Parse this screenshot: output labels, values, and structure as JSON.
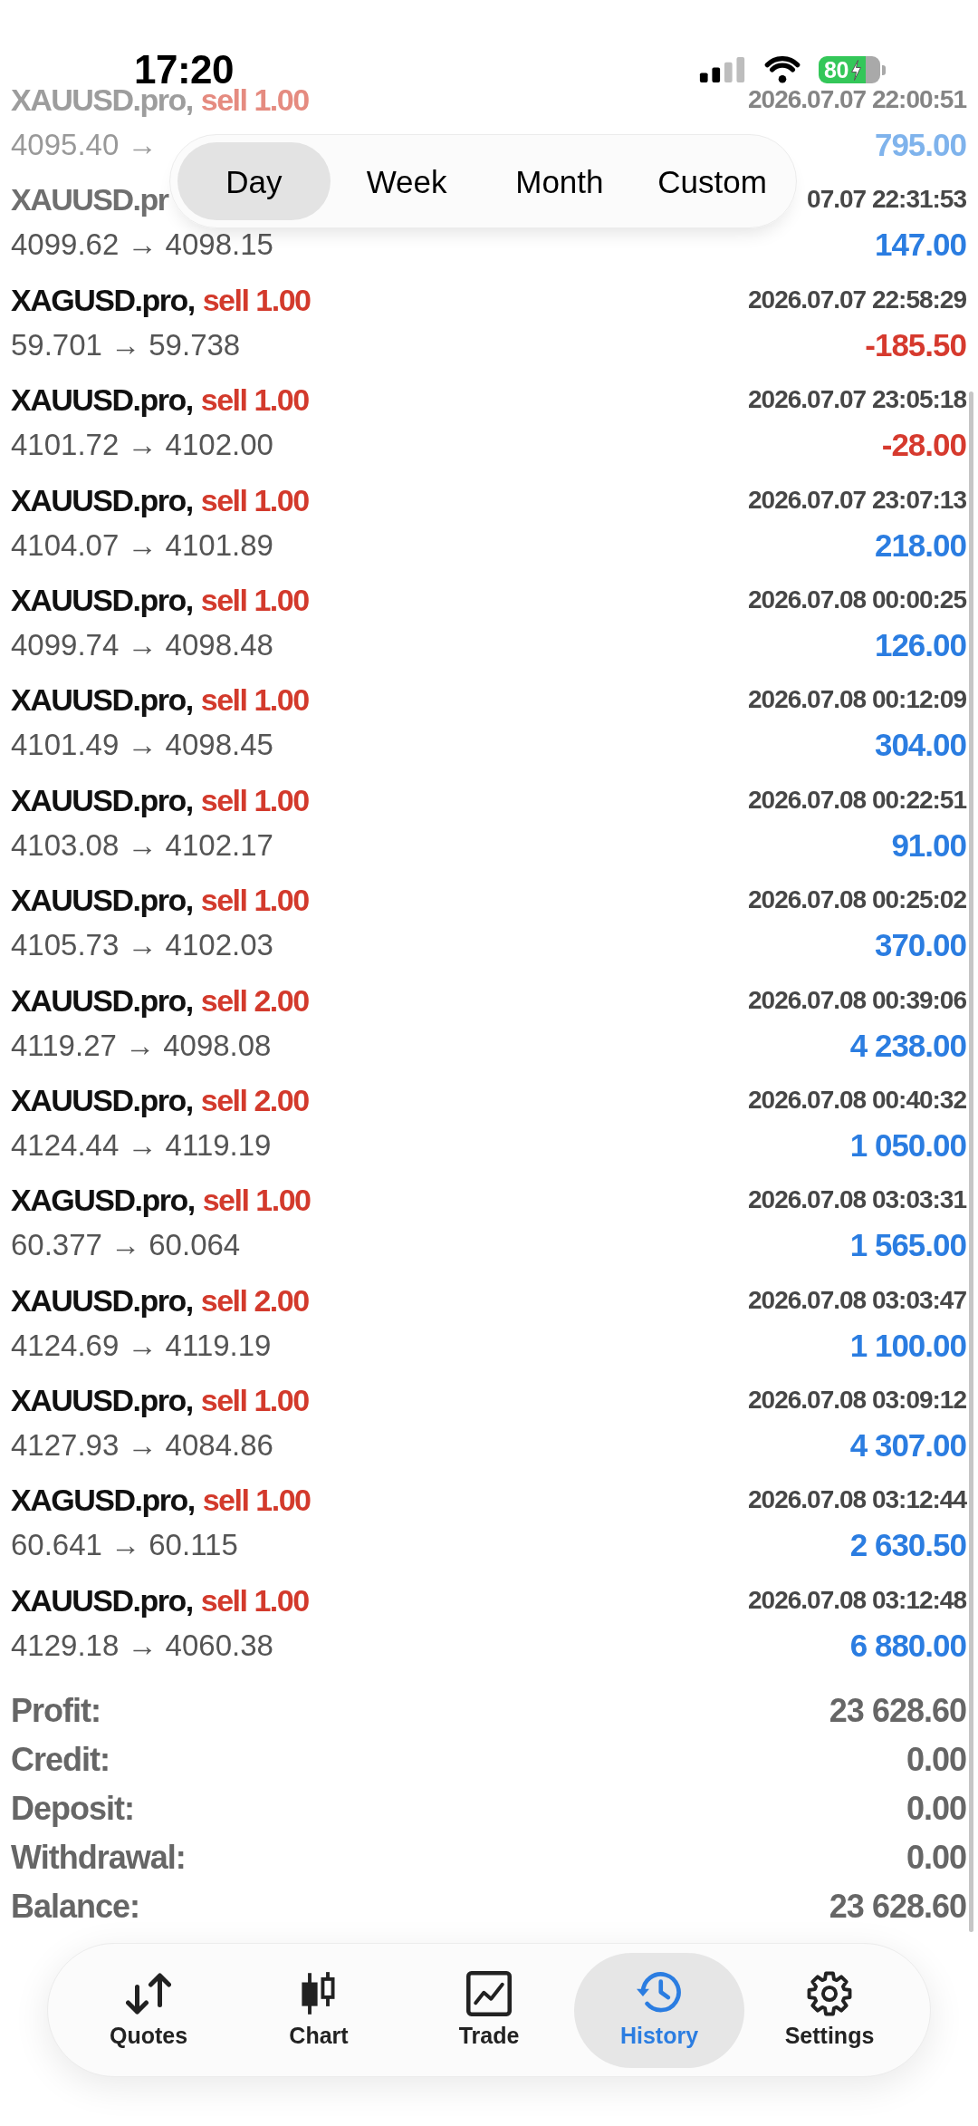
{
  "status_bar": {
    "time": "17:20",
    "battery": "80"
  },
  "period_tabs": [
    {
      "label": "Day",
      "selected": true
    },
    {
      "label": "Week",
      "selected": false
    },
    {
      "label": "Month",
      "selected": false
    },
    {
      "label": "Custom",
      "selected": false
    }
  ],
  "trades": [
    {
      "symbol": "XAUUSD.pro,",
      "side": "sell 1.00",
      "time": "2026.07.07 22:00:51",
      "prices": "4095.40 →",
      "profit": "795.00",
      "color": "#7fb3ec"
    },
    {
      "symbol": "XAUUSD.pr",
      "time": "07.07 22:31:53",
      "prices": "4099.62 → 4098.15",
      "profit": "147.00",
      "color": "#2b7de1"
    },
    {
      "symbol": "XAGUSD.pro,",
      "side": "sell 1.00",
      "time": "2026.07.07 22:58:29",
      "prices": "59.701 → 59.738",
      "profit": "-185.50",
      "color": "#d63a2e"
    },
    {
      "symbol": "XAUUSD.pro,",
      "side": "sell 1.00",
      "time": "2026.07.07 23:05:18",
      "prices": "4101.72 → 4102.00",
      "profit": "-28.00",
      "color": "#d63a2e"
    },
    {
      "symbol": "XAUUSD.pro,",
      "side": "sell 1.00",
      "time": "2026.07.07 23:07:13",
      "prices": "4104.07 → 4101.89",
      "profit": "218.00",
      "color": "#2b7de1"
    },
    {
      "symbol": "XAUUSD.pro,",
      "side": "sell 1.00",
      "time": "2026.07.08 00:00:25",
      "prices": "4099.74 → 4098.48",
      "profit": "126.00",
      "color": "#2b7de1"
    },
    {
      "symbol": "XAUUSD.pro,",
      "side": "sell 1.00",
      "time": "2026.07.08 00:12:09",
      "prices": "4101.49 → 4098.45",
      "profit": "304.00",
      "color": "#2b7de1"
    },
    {
      "symbol": "XAUUSD.pro,",
      "side": "sell 1.00",
      "time": "2026.07.08 00:22:51",
      "prices": "4103.08 → 4102.17",
      "profit": "91.00",
      "color": "#2b7de1"
    },
    {
      "symbol": "XAUUSD.pro,",
      "side": "sell 1.00",
      "time": "2026.07.08 00:25:02",
      "prices": "4105.73 → 4102.03",
      "profit": "370.00",
      "color": "#2b7de1"
    },
    {
      "symbol": "XAUUSD.pro,",
      "side": "sell 2.00",
      "time": "2026.07.08 00:39:06",
      "prices": "4119.27 → 4098.08",
      "profit": "4 238.00",
      "color": "#2b7de1"
    },
    {
      "symbol": "XAUUSD.pro,",
      "side": "sell 2.00",
      "time": "2026.07.08 00:40:32",
      "prices": "4124.44 → 4119.19",
      "profit": "1 050.00",
      "color": "#2b7de1"
    },
    {
      "symbol": "XAGUSD.pro,",
      "side": "sell 1.00",
      "time": "2026.07.08 03:03:31",
      "prices": "60.377 → 60.064",
      "profit": "1 565.00",
      "color": "#2b7de1"
    },
    {
      "symbol": "XAUUSD.pro,",
      "side": "sell 2.00",
      "time": "2026.07.08 03:03:47",
      "prices": "4124.69 → 4119.19",
      "profit": "1 100.00",
      "color": "#2b7de1"
    },
    {
      "symbol": "XAUUSD.pro,",
      "side": "sell 1.00",
      "time": "2026.07.08 03:09:12",
      "prices": "4127.93 → 4084.86",
      "profit": "4 307.00",
      "color": "#2b7de1"
    },
    {
      "symbol": "XAGUSD.pro,",
      "side": "sell 1.00",
      "time": "2026.07.08 03:12:44",
      "prices": "60.641 → 60.115",
      "profit": "2 630.50",
      "color": "#2b7de1"
    },
    {
      "symbol": "XAUUSD.pro,",
      "side": "sell 1.00",
      "time": "2026.07.08 03:12:48",
      "prices": "4129.18 → 4060.38",
      "profit": "6 880.00",
      "color": "#2b7de1"
    }
  ],
  "summary": [
    {
      "label": "Profit:",
      "value": "23 628.60"
    },
    {
      "label": "Credit:",
      "value": "0.00"
    },
    {
      "label": "Deposit:",
      "value": "0.00"
    },
    {
      "label": "Withdrawal:",
      "value": "0.00"
    },
    {
      "label": "Balance:",
      "value": "23 628.60"
    }
  ],
  "tab_bar": [
    {
      "label": "Quotes",
      "selected": false
    },
    {
      "label": "Chart",
      "selected": false
    },
    {
      "label": "Trade",
      "selected": false
    },
    {
      "label": "History",
      "selected": true
    },
    {
      "label": "Settings",
      "selected": false
    }
  ]
}
